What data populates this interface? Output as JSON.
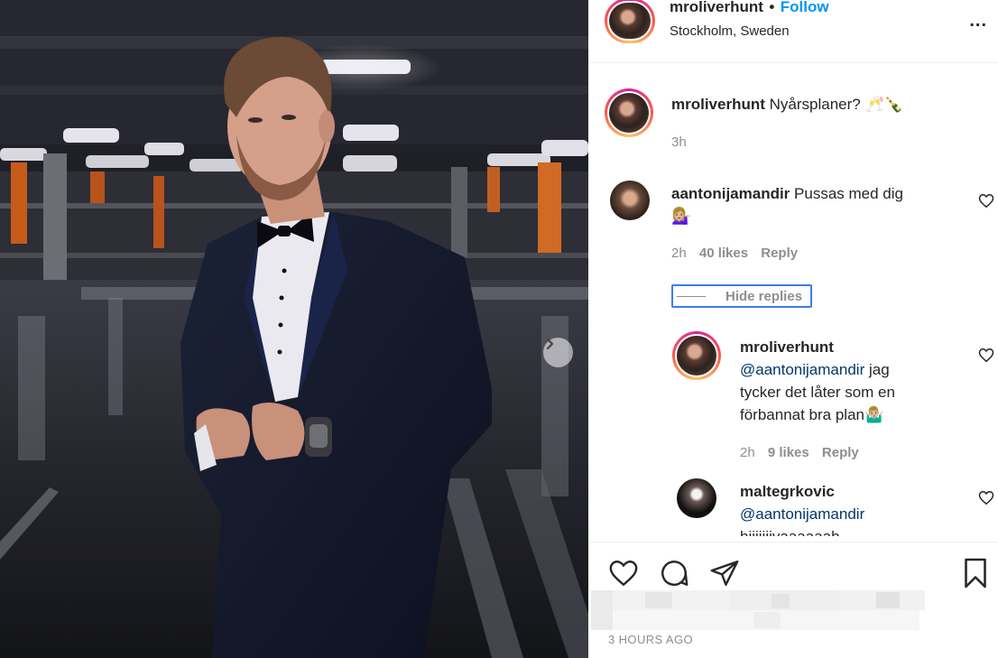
{
  "post": {
    "username": "mroliverhunt",
    "follow_separator": "•",
    "follow_label": "Follow",
    "location": "Stockholm, Sweden",
    "more_label": "..."
  },
  "caption": {
    "username": "mroliverhunt",
    "text": "Nyårsplaner? 🥂🍾",
    "time": "3h"
  },
  "comments": [
    {
      "username": "aantonijamandir",
      "text": "Pussas med dig",
      "emoji": "💁🏼‍♀️",
      "time": "2h",
      "likes": "40 likes",
      "reply_label": "Reply"
    }
  ],
  "hide_replies_label": "Hide replies",
  "replies": [
    {
      "username": "mroliverhunt",
      "mention": "@aantonijamandir",
      "text_line1": "jag",
      "text_line2": "tycker det låter som en",
      "text_line3": "förbannat bra plan🤷🏼‍♂️",
      "time": "2h",
      "likes": "9 likes",
      "reply_label": "Reply"
    },
    {
      "username": "maltegrkovic",
      "mention": "@aantonijamandir",
      "text_partial": "hiiiiiiivaaaaaah"
    }
  ],
  "footer": {
    "timestamp": "3 HOURS AGO"
  },
  "colors": {
    "accent": "#0095f6",
    "mention": "#00376b",
    "muted": "#8e8e8e",
    "focus": "#3b7ee8"
  }
}
